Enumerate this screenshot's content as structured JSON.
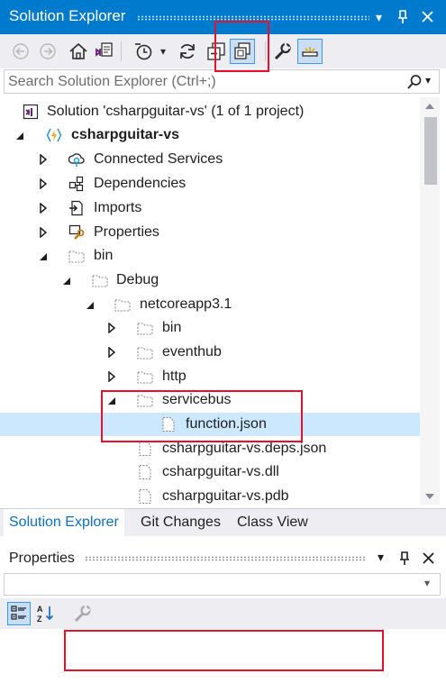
{
  "window": {
    "title": "Solution Explorer"
  },
  "search": {
    "placeholder": "Search Solution Explorer (Ctrl+;)"
  },
  "tree": {
    "solution": "Solution 'csharpguitar-vs' (1 of 1 project)",
    "project": "csharpguitar-vs",
    "connected_services": "Connected Services",
    "dependencies": "Dependencies",
    "imports": "Imports",
    "properties": "Properties",
    "bin": "bin",
    "debug": "Debug",
    "netcoreapp": "netcoreapp3.1",
    "sub_bin": "bin",
    "eventhub": "eventhub",
    "http": "http",
    "servicebus": "servicebus",
    "function_json": "function.json",
    "deps_json": "csharpguitar-vs.deps.json",
    "dll": "csharpguitar-vs.dll",
    "pdb": "csharpguitar-vs.pdb"
  },
  "tabs": [
    "Solution Explorer",
    "Git Changes",
    "Class View"
  ],
  "properties_panel": {
    "title": "Properties"
  },
  "colors": {
    "accent": "#007acc",
    "selection": "#cce8ff",
    "highlight_box": "#e8102a"
  }
}
